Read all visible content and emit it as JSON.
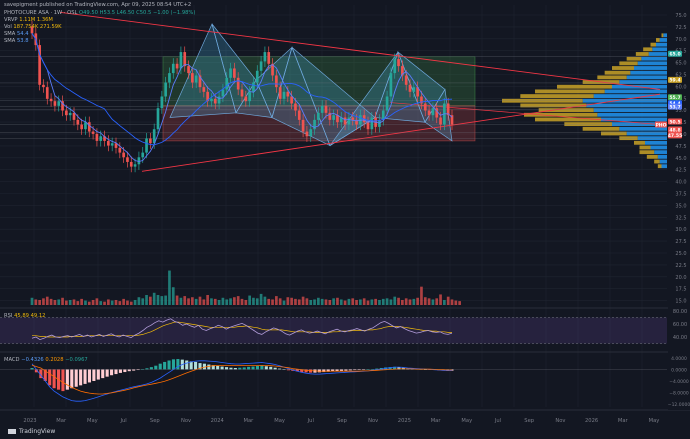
{
  "header": {
    "published": "savepigment published on TradingView.com, Apr 09, 2025 08:54 UTC+2",
    "symbol_line": "PHOTOCURE ASA · 1W · OSL",
    "symbol_ohlc": "O49.50 H53.5 L46.50 C50.5",
    "symbol_change": "−1.00 (−1.98%)",
    "vrvp_line": "VRVP",
    "vrvp_values": "1.11M 1.36M",
    "vol_line": "Vol",
    "vol_values": "187.754K 271.59K",
    "sma1_line": "SMA",
    "sma1_value": "54.4",
    "sma2_line": "SMA",
    "sma2_value": "53.8"
  },
  "rsi_header": {
    "label": "RSI",
    "values": "45.89",
    "values2": "49.12"
  },
  "macd_header": {
    "label": "MACD",
    "v1": "−0.4326",
    "v2": "0.2028",
    "v3": "−0.0967"
  },
  "footer": {
    "brand": "TradingView"
  },
  "colors": {
    "background": "#131722",
    "grid": "#1f2430",
    "up": "#26a69a",
    "down": "#ef5350",
    "sma_fast": "#5b7cfa",
    "sma_slow": "#2962ff",
    "pattern_fill": "#4fc3f7",
    "range_green": "#4caf50",
    "range_red": "#ef5350",
    "profile_up": "#2196f3",
    "profile_down": "#c9a227",
    "rsi_band": "#7e57c2",
    "trendline": "#f23645"
  },
  "chart_data": [
    {
      "type": "candlestick",
      "name": "price",
      "scale": "right",
      "ylim": [
        36.5,
        75
      ],
      "yticks": [
        "75.0",
        "72.5",
        "70.0",
        "67.5",
        "65.0",
        "62.5",
        "60.0",
        "57.5",
        "55.0",
        "52.5",
        "50.0",
        "47.5",
        "45.0",
        "42.5",
        "40.0",
        "37.5",
        "35.0",
        "32.5",
        "30.0",
        "27.5",
        "25.0",
        "22.5",
        "20.0",
        "17.5",
        "15.0"
      ],
      "xticks": [
        "2023",
        "Mar",
        "May",
        "Jul",
        "Sep",
        "Nov",
        "2024",
        "Mar",
        "May",
        "Jul",
        "Sep",
        "Nov",
        "2025",
        "Mar",
        "May",
        "Jul",
        "Sep",
        "Nov",
        "2026",
        "Mar",
        "May"
      ],
      "price_labels": [
        {
          "text": "65.0",
          "value": 65.0
        },
        {
          "text": "59.4",
          "value": 59.4
        },
        {
          "text": "55.7",
          "value": 55.7
        },
        {
          "text": "54.4",
          "value": 54.4
        },
        {
          "text": "53.7",
          "value": 53.7
        },
        {
          "text": "PHO",
          "value": 50.5
        },
        {
          "text": "50.5",
          "value": 50.5
        },
        {
          "text": "48.8",
          "value": 48.8
        },
        {
          "text": "47.55",
          "value": 47.55
        }
      ],
      "closes": [
        70,
        67.5,
        59,
        58.5,
        56,
        55.5,
        54.5,
        55.5,
        53.5,
        52.5,
        53,
        51.5,
        50.5,
        49.5,
        51,
        49,
        48.5,
        47,
        48,
        47,
        46,
        46.5,
        45.5,
        44.5,
        43.5,
        42.5,
        41.5,
        42,
        43.5,
        44.5,
        47.5,
        46.5,
        49.5,
        54,
        56.5,
        59.5,
        61.5,
        63.5,
        62.5,
        66,
        63,
        61.5,
        59.5,
        61,
        58.5,
        57.5,
        55.5,
        56,
        55,
        56.5,
        58,
        60.5,
        62.5,
        60.5,
        58,
        56.5,
        55.5,
        57.5,
        59.5,
        62,
        64,
        66,
        63.5,
        61,
        58.5,
        56,
        57.5,
        56.5,
        55,
        53.5,
        51.5,
        49,
        48,
        49.5,
        51.5,
        53,
        54.5,
        53,
        51.5,
        52.5,
        51,
        52,
        50.5,
        52,
        51.5,
        50.5,
        52.5,
        51,
        49.5,
        52,
        50,
        51.5,
        53.5,
        56.5,
        61.5,
        64.5,
        63,
        61,
        59,
        57.5,
        58.5,
        56.5,
        55,
        53.5,
        52.5,
        54,
        52,
        50.5,
        55,
        52.5,
        50.5
      ],
      "volume": {
        "ylim": [
          0,
          13.5
        ],
        "unit": "relative",
        "values": [
          1.3,
          1.0,
          0.9,
          1.2,
          1.5,
          1.1,
          0.9,
          1.0,
          1.3,
          0.8,
          0.9,
          1.0,
          0.7,
          1.1,
          0.8,
          0.6,
          0.9,
          1.2,
          0.7,
          0.6,
          1.0,
          0.8,
          0.9,
          0.7,
          1.1,
          0.8,
          0.6,
          0.9,
          1.4,
          1.2,
          1.8,
          1.5,
          2.2,
          1.8,
          1.6,
          1.7,
          6.2,
          3.2,
          1.7,
          1.3,
          1.6,
          1.2,
          1.4,
          1.1,
          1.5,
          1.0,
          1.8,
          1.2,
          1.1,
          0.9,
          1.3,
          1.0,
          1.2,
          1.4,
          1.6,
          1.1,
          0.9,
          1.7,
          1.3,
          1.2,
          2.0,
          1.5,
          1.1,
          1.0,
          1.6,
          1.2,
          0.8,
          1.4,
          1.3,
          1.1,
          1.0,
          1.5,
          1.2,
          0.9,
          1.0,
          1.3,
          1.1,
          1.0,
          0.9,
          1.2,
          1.3,
          1.0,
          0.8,
          1.1,
          1.2,
          0.9,
          1.0,
          1.2,
          0.8,
          1.0,
          1.1,
          0.9,
          1.1,
          1.2,
          1.0,
          1.5,
          1.3,
          0.9,
          1.2,
          1.0,
          1.1,
          1.3,
          3.3,
          1.4,
          1.2,
          1.0,
          1.2,
          1.9,
          0.9,
          1.5,
          1.0,
          0.8,
          0.7
        ]
      }
    },
    {
      "type": "line",
      "name": "RSI",
      "ylim": [
        20,
        80
      ],
      "yticks": [
        "80.00",
        "60.00",
        "40.00"
      ],
      "band": [
        30,
        70
      ],
      "rsi": [
        38,
        40,
        36,
        38,
        41,
        43,
        40,
        39,
        41,
        42,
        40,
        42,
        44,
        41,
        43,
        40,
        42,
        44,
        41,
        43,
        45,
        42,
        40,
        43,
        41,
        39,
        43,
        46,
        50,
        55,
        58,
        62,
        65,
        63,
        66,
        68,
        64,
        62,
        58,
        60,
        57,
        55,
        58,
        52,
        50,
        53,
        55,
        58,
        56,
        52,
        55,
        57,
        59,
        61,
        58,
        54,
        50,
        46,
        44,
        48,
        51,
        54,
        52,
        49,
        45,
        43,
        46,
        49,
        51,
        48,
        46,
        47,
        49,
        47,
        45,
        48,
        50,
        52,
        49,
        48,
        50,
        51,
        53,
        51,
        49,
        52,
        54,
        58,
        62,
        64,
        61,
        57,
        54,
        56,
        53,
        50,
        48,
        46,
        47,
        49,
        50,
        48,
        47,
        48,
        45,
        44,
        46
      ],
      "signal": [
        42,
        42,
        41,
        41,
        40,
        40,
        40,
        40,
        40,
        40,
        41,
        41,
        41,
        41,
        42,
        42,
        42,
        42,
        42,
        42,
        42,
        42,
        42,
        42,
        42,
        42,
        42,
        43,
        44,
        46,
        48,
        51,
        54,
        57,
        59,
        61,
        63,
        63,
        62,
        61,
        60,
        59,
        58,
        57,
        56,
        55,
        55,
        55,
        55,
        55,
        55,
        55,
        56,
        56,
        57,
        56,
        55,
        54,
        52,
        51,
        51,
        51,
        51,
        51,
        50,
        49,
        48,
        48,
        48,
        48,
        48,
        47,
        47,
        47,
        47,
        47,
        48,
        48,
        49,
        49,
        49,
        50,
        50,
        50,
        50,
        51,
        51,
        52,
        53,
        55,
        56,
        56,
        56,
        56,
        55,
        54,
        53,
        52,
        51,
        50,
        50,
        49,
        49,
        48,
        48,
        47,
        47
      ]
    },
    {
      "type": "bar",
      "name": "MACD",
      "ylim": [
        -13,
        5
      ],
      "yticks": [
        "4.0000",
        "0.0000",
        "−4.0000",
        "−8.0000",
        "−12.0000"
      ],
      "histogram": [
        0.5,
        -1,
        -3,
        -4,
        -5.5,
        -6.5,
        -7,
        -7.5,
        -7,
        -6.5,
        -6,
        -5.5,
        -5,
        -4.5,
        -4,
        -3.5,
        -3,
        -2.5,
        -2,
        -1.6,
        -1.2,
        -0.9,
        -0.6,
        -0.4,
        -0.2,
        0.1,
        0.4,
        0.8,
        1.3,
        2,
        2.6,
        3.1,
        3.5,
        3.6,
        3.4,
        3.1,
        2.8,
        2.6,
        2.2,
        2,
        1.7,
        1.5,
        1.2,
        1,
        0.8,
        0.6,
        0.5,
        0.6,
        0.7,
        0.9,
        1,
        1.2,
        1.3,
        1.1,
        0.9,
        0.6,
        0.3,
        0,
        -0.3,
        -0.5,
        -0.7,
        -0.9,
        -1,
        -1.1,
        -1.1,
        -1,
        -0.9,
        -0.8,
        -0.7,
        -0.6,
        -0.5,
        -0.4,
        -0.3,
        -0.2,
        -0.2,
        -0.1,
        0,
        0.1,
        0.3,
        0.5,
        0.7,
        0.8,
        0.9,
        0.8,
        0.6,
        0.4,
        0.3,
        0.2,
        0.1,
        0,
        -0.1,
        -0.2,
        -0.3,
        -0.4,
        -0.4,
        -0.4
      ],
      "macd": [
        2,
        0,
        -2,
        -4,
        -6,
        -7.5,
        -8.5,
        -9.5,
        -10.2,
        -10.8,
        -11,
        -11,
        -10.8,
        -10.4,
        -10,
        -9.5,
        -9,
        -8.5,
        -8,
        -7.6,
        -7.2,
        -6.8,
        -6.4,
        -6,
        -5.7,
        -5.4,
        -5,
        -4.5,
        -3.8,
        -3,
        -2,
        -1,
        0,
        1,
        1.7,
        2.2,
        2.6,
        2.9,
        3,
        3,
        2.9,
        2.8,
        2.6,
        2.4,
        2.2,
        2,
        1.9,
        1.9,
        2,
        2.1,
        2.2,
        2.3,
        2.4,
        2.2,
        2,
        1.7,
        1.3,
        0.8,
        0.3,
        -0.2,
        -0.6,
        -1,
        -1.3,
        -1.5,
        -1.6,
        -1.6,
        -1.5,
        -1.4,
        -1.3,
        -1.2,
        -1.1,
        -1,
        -0.9,
        -0.8,
        -0.7,
        -0.6,
        -0.5,
        -0.3,
        -0.1,
        0.1,
        0.4,
        0.6,
        0.8,
        0.8,
        0.7,
        0.5,
        0.4,
        0.3,
        0.2,
        0.1,
        0,
        -0.1,
        -0.2,
        -0.3,
        -0.4,
        -0.4
      ],
      "signal": [
        1.5,
        1,
        0.5,
        -0.5,
        -1.5,
        -2.5,
        -3.5,
        -4.5,
        -5.4,
        -6.2,
        -6.9,
        -7.5,
        -7.9,
        -8.2,
        -8.4,
        -8.5,
        -8.5,
        -8.3,
        -8.1,
        -7.8,
        -7.5,
        -7.2,
        -6.8,
        -6.4,
        -6,
        -5.7,
        -5.4,
        -5.1,
        -4.8,
        -4.5,
        -4.1,
        -3.6,
        -3,
        -2.4,
        -1.8,
        -1.2,
        -0.6,
        -0.1,
        0.4,
        0.8,
        1.1,
        1.3,
        1.4,
        1.4,
        1.4,
        1.4,
        1.4,
        1.4,
        1.4,
        1.4,
        1.4,
        1.4,
        1.4,
        1.4,
        1.3,
        1.2,
        1,
        0.8,
        0.6,
        0.3,
        0.1,
        -0.1,
        -0.3,
        -0.4,
        -0.5,
        -0.6,
        -0.6,
        -0.6,
        -0.6,
        -0.6,
        -0.6,
        -0.6,
        -0.6,
        -0.6,
        -0.6,
        -0.5,
        -0.5,
        -0.4,
        -0.3,
        -0.2,
        -0.1,
        0,
        0.1,
        0.2,
        0.2,
        0.2,
        0.2,
        0.1,
        0.1,
        0.1,
        0.1,
        0,
        -0.1,
        -0.1,
        -0.2,
        -0.2
      ]
    },
    {
      "type": "bar",
      "name": "volume-profile",
      "orientation": "horizontal",
      "price_min": 41,
      "price_max": 70,
      "rows": [
        {
          "price": 69.5,
          "up": 2,
          "down": 1
        },
        {
          "price": 68.5,
          "up": 4,
          "down": 2
        },
        {
          "price": 67.5,
          "up": 6,
          "down": 3
        },
        {
          "price": 66.5,
          "up": 8,
          "down": 5
        },
        {
          "price": 65.5,
          "up": 10,
          "down": 7
        },
        {
          "price": 64.5,
          "up": 14,
          "down": 8
        },
        {
          "price": 63.5,
          "up": 16,
          "down": 10
        },
        {
          "price": 62.5,
          "up": 18,
          "down": 12
        },
        {
          "price": 61.5,
          "up": 20,
          "down": 14
        },
        {
          "price": 60.5,
          "up": 22,
          "down": 16
        },
        {
          "price": 59.5,
          "up": 26,
          "down": 20
        },
        {
          "price": 58.5,
          "up": 30,
          "down": 30
        },
        {
          "price": 57.5,
          "up": 34,
          "down": 38
        },
        {
          "price": 56.5,
          "up": 40,
          "down": 40
        },
        {
          "price": 55.5,
          "up": 46,
          "down": 44
        },
        {
          "price": 54.5,
          "up": 44,
          "down": 36
        },
        {
          "price": 53.5,
          "up": 40,
          "down": 30
        },
        {
          "price": 52.5,
          "up": 38,
          "down": 40
        },
        {
          "price": 51.5,
          "up": 36,
          "down": 36
        },
        {
          "price": 50.5,
          "up": 30,
          "down": 26
        },
        {
          "price": 49.5,
          "up": 26,
          "down": 20
        },
        {
          "price": 48.5,
          "up": 22,
          "down": 14
        },
        {
          "price": 47.5,
          "up": 16,
          "down": 10
        },
        {
          "price": 46.5,
          "up": 12,
          "down": 6
        },
        {
          "price": 45.5,
          "up": 9,
          "down": 6
        },
        {
          "price": 44.5,
          "up": 7,
          "down": 8
        },
        {
          "price": 43.5,
          "up": 5,
          "down": 6
        },
        {
          "price": 42.5,
          "up": 4,
          "down": 3
        },
        {
          "price": 41.5,
          "up": 3,
          "down": 2
        }
      ]
    }
  ]
}
